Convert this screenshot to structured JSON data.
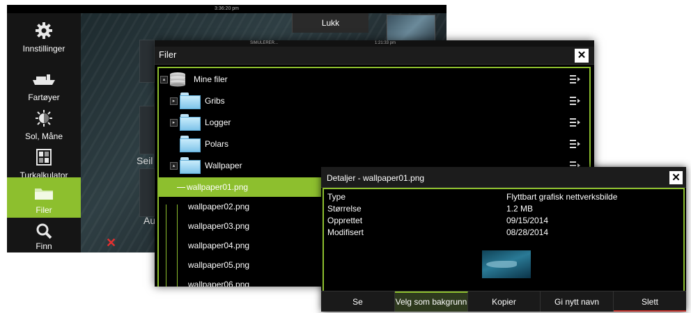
{
  "back_screen": {
    "status_time": "3:36:20 pm",
    "close_label": "Lukk",
    "tile_label_1": "Seil",
    "tile_label_2": "Au",
    "sidebar": {
      "items": [
        {
          "label": "Innstillinger",
          "icon": "gear-icon"
        },
        {
          "label": "Fartøyer",
          "icon": "vessel-icon"
        },
        {
          "label": "Sol, Måne",
          "icon": "sun-moon-icon"
        },
        {
          "label": "Turkalkulator",
          "icon": "calculator-icon"
        },
        {
          "label": "Filer",
          "icon": "folder-icon",
          "active": true
        },
        {
          "label": "Finn",
          "icon": "search-icon"
        }
      ]
    }
  },
  "files_dialog": {
    "status_left": "SIMULERER...",
    "status_time": "1:21:33 pm",
    "title": "Filer",
    "close_label": "✕",
    "tree": [
      {
        "label": "Mine filer",
        "type": "drive",
        "expanded": true
      },
      {
        "label": "Gribs",
        "type": "folder"
      },
      {
        "label": "Logger",
        "type": "folder"
      },
      {
        "label": "Polars",
        "type": "folder"
      },
      {
        "label": "Wallpaper",
        "type": "folder",
        "expanded": true
      },
      {
        "label": "wallpaper01.png",
        "type": "file",
        "selected": true
      },
      {
        "label": "wallpaper02.png",
        "type": "file"
      },
      {
        "label": "wallpaper03.png",
        "type": "file"
      },
      {
        "label": "wallpaper04.png",
        "type": "file"
      },
      {
        "label": "wallpaper05.png",
        "type": "file"
      },
      {
        "label": "wallpaper06.png",
        "type": "file"
      }
    ]
  },
  "details_dialog": {
    "title": "Detaljer - wallpaper01.png",
    "close_label": "✕",
    "properties": [
      {
        "name": "Type",
        "value": "Flyttbart grafisk nettverksbilde"
      },
      {
        "name": "Størrelse",
        "value": "1.2 MB"
      },
      {
        "name": "Opprettet",
        "value": "09/15/2014"
      },
      {
        "name": "Modifisert",
        "value": "08/28/2014"
      }
    ],
    "buttons": {
      "view": "Se",
      "set_background": "Velg som bakgrunn",
      "copy": "Kopier",
      "rename": "Gi nytt navn",
      "delete": "Slett"
    }
  },
  "colors": {
    "accent": "#8dbf2e",
    "delete": "#c0302a"
  }
}
